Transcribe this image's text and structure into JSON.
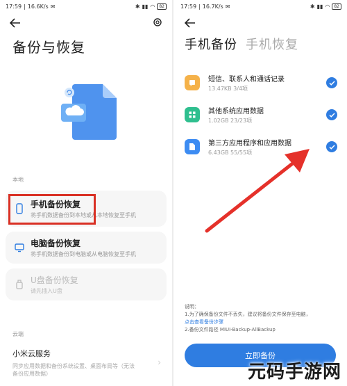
{
  "left": {
    "status": {
      "time": "17:59",
      "speed": "16.6K/s",
      "battery": "82"
    },
    "title": "备份与恢复",
    "section_local": "本地",
    "cards": [
      {
        "title": "手机备份恢复",
        "desc": "将手机数据备份到本地或从本地恢复至手机"
      },
      {
        "title": "电脑备份恢复",
        "desc": "将手机数据备份到电脑或从电脑恢复至手机"
      },
      {
        "title": "U盘备份恢复",
        "desc": "请先插入U盘"
      }
    ],
    "section_cloud": "云端",
    "cloud": {
      "title": "小米云服务",
      "desc1": "同步应用数据和备份系统设置、桌面布局等（无法",
      "desc2": "备份应用数据）"
    }
  },
  "right": {
    "status": {
      "time": "17:59",
      "speed": "16.7K/s",
      "battery": "82"
    },
    "tabs": [
      "手机备份",
      "手机恢复"
    ],
    "items": [
      {
        "title": "短信、联系人和通话记录",
        "meta": "13.47KB  3/4项",
        "color": "#f5b24a",
        "icon": "message-icon"
      },
      {
        "title": "其他系统应用数据",
        "meta": "1.02GB  23/23项",
        "color": "#2fbf8f",
        "icon": "apps-icon"
      },
      {
        "title": "第三方应用程序和应用数据",
        "meta": "6.43GB  55/55项",
        "color": "#3d8cf2",
        "icon": "file-icon"
      }
    ],
    "note": {
      "label": "说明：",
      "line1": "1.为了确保备份文件不丢失，建议将备份文件保存至电脑，",
      "link": "点击查看备份步骤",
      "line2": "2.备份文件路径 MIUI-Backup-AllBackup"
    },
    "button": "立即备份"
  },
  "watermark": "元码手游网",
  "colors": {
    "accent": "#2f7de1",
    "highlight": "#d93024",
    "arrow": "#e5312a"
  }
}
